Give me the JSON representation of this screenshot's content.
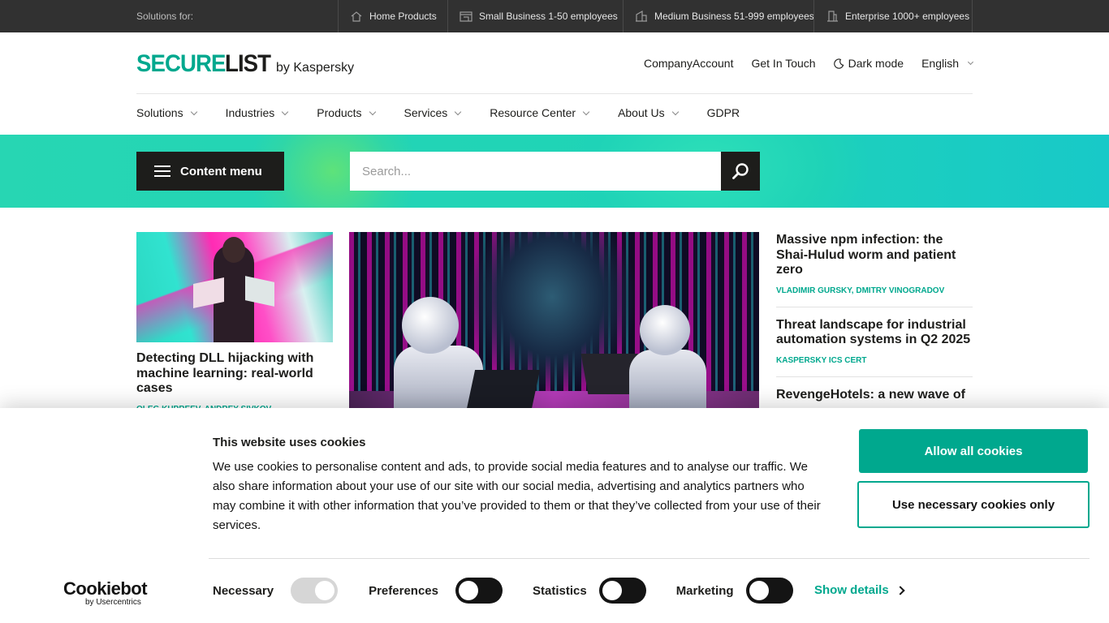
{
  "topbar": {
    "solutions_label": "Solutions for:",
    "segments": [
      {
        "label": "Home Products",
        "icon": "house-icon"
      },
      {
        "label": "Small Business 1-50 employees",
        "icon": "shop-icon"
      },
      {
        "label": "Medium Business 51-999 employees",
        "icon": "building-icon"
      },
      {
        "label": "Enterprise 1000+ employees",
        "icon": "skyscraper-icon"
      }
    ]
  },
  "header": {
    "logo_part1": "SECURE",
    "logo_part2": "LIST",
    "logo_by": "by Kaspersky",
    "links": {
      "company_account": "CompanyAccount",
      "get_in_touch": "Get In Touch",
      "dark_mode": "Dark mode",
      "language": "English"
    }
  },
  "mainnav": [
    {
      "label": "Solutions",
      "has_dropdown": true
    },
    {
      "label": "Industries",
      "has_dropdown": true
    },
    {
      "label": "Products",
      "has_dropdown": true
    },
    {
      "label": "Services",
      "has_dropdown": true
    },
    {
      "label": "Resource Center",
      "has_dropdown": true
    },
    {
      "label": "About Us",
      "has_dropdown": true
    },
    {
      "label": "GDPR",
      "has_dropdown": false
    }
  ],
  "search": {
    "content_menu_label": "Content menu",
    "placeholder": "Search..."
  },
  "articles": {
    "left": {
      "title": "Detecting DLL hijacking with machine learning: real-world cases",
      "authors": "Oleg Kupreev, Andrey Sivkov"
    },
    "side": [
      {
        "title": "Massive npm infection: the Shai-Hulud worm and patient zero",
        "authors": [
          "Vladimir Gursky",
          "Dmitry Vinogradov"
        ]
      },
      {
        "title": "Threat landscape for industrial automation systems in Q2 2025",
        "authors": [
          "Kaspersky ICS CERT"
        ]
      },
      {
        "title": "RevengeHotels: a new wave of",
        "authors": []
      }
    ]
  },
  "cookie": {
    "title": "This website uses cookies",
    "text": "We use cookies to personalise content and ads, to provide social media features and to analyse our traffic. We also share information about your use of our site with our social media, advertising and analytics partners who may combine it with other information that you’ve provided to them or that they’ve collected from your use of their services.",
    "allow_all": "Allow all cookies",
    "necessary_only": "Use necessary cookies only",
    "logo_main": "Cookiebot",
    "logo_sub": "by Usercentrics",
    "toggles": {
      "necessary": "Necessary",
      "preferences": "Preferences",
      "statistics": "Statistics",
      "marketing": "Marketing"
    },
    "show_details": "Show details"
  },
  "colors": {
    "accent": "#00a88e",
    "topbar_bg": "#313131",
    "dark_button": "#1d1d1b"
  }
}
